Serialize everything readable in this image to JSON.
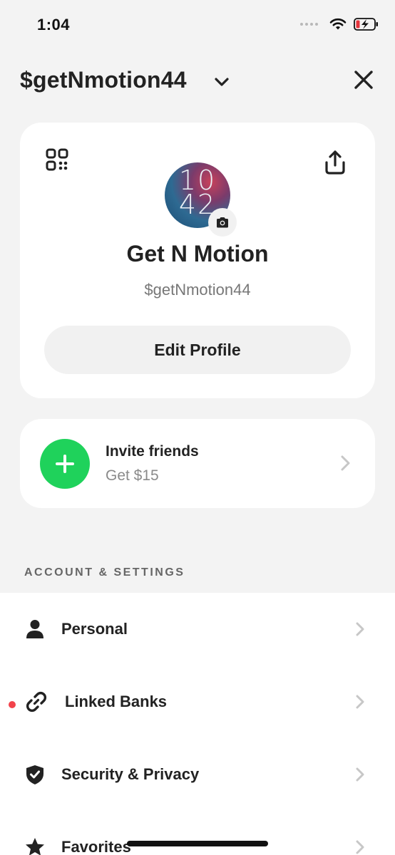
{
  "status_bar": {
    "time": "1:04"
  },
  "header": {
    "cashtag": "$getNmotion44"
  },
  "profile": {
    "avatar_time_hour": "10",
    "avatar_time_minute": "42",
    "name": "Get N Motion",
    "cashtag": "$getNmotion44",
    "edit_button_label": "Edit Profile"
  },
  "invite": {
    "title": "Invite friends",
    "subtitle": "Get $15"
  },
  "settings": {
    "section_title": "ACCOUNT & SETTINGS",
    "items": [
      {
        "label": "Personal",
        "icon": "person-icon"
      },
      {
        "label": "Linked Banks",
        "icon": "link-icon",
        "badge": "red-dot"
      },
      {
        "label": "Security & Privacy",
        "icon": "shield-check-icon"
      },
      {
        "label": "Favorites",
        "icon": "star-icon"
      }
    ]
  },
  "colors": {
    "background": "#f3f3f3",
    "card": "#ffffff",
    "accent_green": "#1fd25b",
    "badge_red": "#f2434b",
    "battery_red": "#e5343c"
  }
}
